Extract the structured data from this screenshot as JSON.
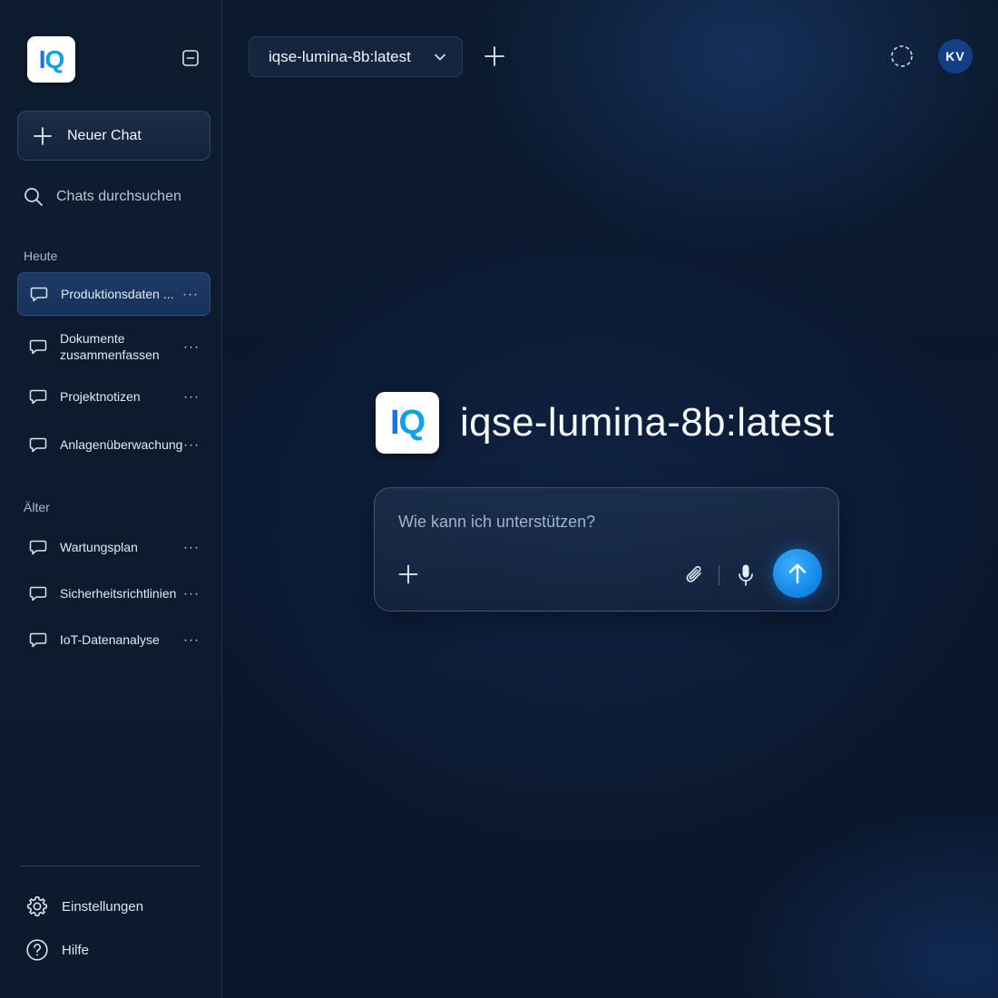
{
  "app": {
    "logo_text_a": "I",
    "logo_text_b": "Q",
    "accent": "#1a73e8",
    "send_color": "#1184e6"
  },
  "sidebar": {
    "new_chat_label": "Neuer Chat",
    "search_label": "Chats durchsuchen",
    "sections": [
      {
        "label": "Heute",
        "items": [
          {
            "label": "Produktionsdaten ...",
            "active": true
          },
          {
            "label": "Dokumente zusammenfassen"
          },
          {
            "label": "Projektnotizen"
          },
          {
            "label": "Anlagenüberwachung"
          }
        ]
      },
      {
        "label": "Älter",
        "items": [
          {
            "label": "Wartungsplan"
          },
          {
            "label": "Sicherheitsrichtlinien"
          },
          {
            "label": "IoT-Datenanalyse"
          }
        ]
      }
    ],
    "more_label": "···",
    "bottom": [
      {
        "label": "Einstellungen",
        "icon": "gear-icon"
      },
      {
        "label": "Hilfe",
        "icon": "help-circle-icon"
      }
    ]
  },
  "topbar": {
    "model_name": "iqse-lumina-8b:latest",
    "avatar_initials": "KV"
  },
  "main": {
    "title": "iqse-lumina-8b:latest",
    "composer_placeholder": "Wie kann ich unterstützen?"
  }
}
